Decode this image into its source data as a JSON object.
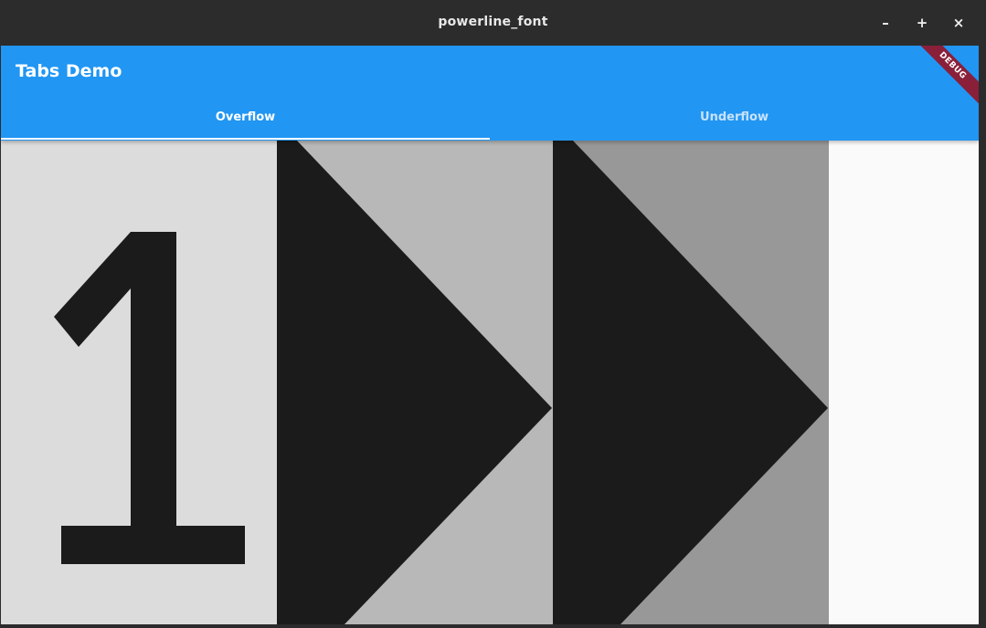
{
  "window": {
    "title": "powerline_font",
    "minimize": "–",
    "maximize": "+",
    "close": "×"
  },
  "appbar": {
    "title": "Tabs Demo",
    "banner": "DEBUG"
  },
  "tabs": [
    {
      "label": "Overflow"
    },
    {
      "label": "Underflow"
    }
  ],
  "colors": {
    "primary": "#2196f3",
    "glyph": "#1b1b1b",
    "seg1": "#dcdcdc",
    "seg2": "#b8b8b8",
    "seg3": "#989898"
  },
  "content": {
    "glyph_text": "1"
  }
}
